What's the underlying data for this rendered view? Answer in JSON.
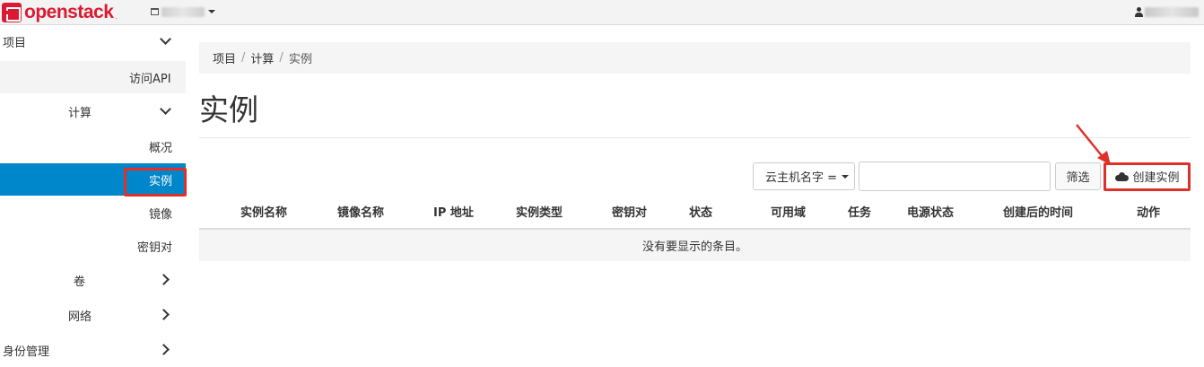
{
  "navbar": {
    "brand": "openstack",
    "brand_suffix": ".",
    "project_picker": "",
    "user": ""
  },
  "sidebar": {
    "items": [
      {
        "label": "项目",
        "expandable": "down"
      },
      {
        "label": "访问API"
      },
      {
        "label": "计算",
        "expandable": "down"
      },
      {
        "label": "概况"
      },
      {
        "label": "实例",
        "active": true
      },
      {
        "label": "镜像"
      },
      {
        "label": "密钥对"
      },
      {
        "label": "卷",
        "expandable": "right"
      },
      {
        "label": "网络",
        "expandable": "right"
      },
      {
        "label": "身份管理",
        "expandable": "right"
      }
    ]
  },
  "breadcrumb": {
    "items": [
      "项目",
      "计算",
      "实例"
    ],
    "separator": "/"
  },
  "page": {
    "title": "实例"
  },
  "filter": {
    "select_label": "云主机名字 =",
    "input_value": "",
    "filter_button": "筛选",
    "create_button": "创建实例"
  },
  "table": {
    "headers": [
      "实例名称",
      "镜像名称",
      "IP 地址",
      "实例类型",
      "密钥对",
      "状态",
      "可用域",
      "任务",
      "电源状态",
      "创建后的时间",
      "动作"
    ],
    "empty_message": "没有要显示的条目。"
  },
  "colors": {
    "brand": "#da1a32",
    "active_nav": "#0086ca",
    "highlight": "#e0302a"
  }
}
